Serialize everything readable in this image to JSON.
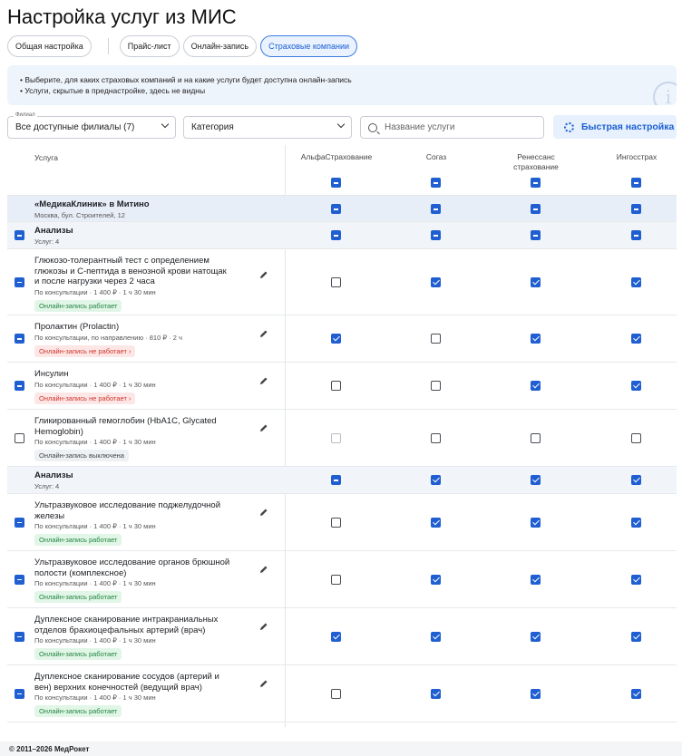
{
  "page_title": "Настройка услуг из МИС",
  "tabs": [
    {
      "label": "Общая настройка"
    },
    {
      "label": "Прайс-лист"
    },
    {
      "label": "Онлайн-запись"
    },
    {
      "label": "Страховые компании",
      "active": true
    }
  ],
  "info": {
    "lines": [
      "•  Выберите, для каких страховых компаний и на какие услуги будет доступна онлайн-запись",
      "•  Услуги, скрытые в преднастройке, здесь не видны"
    ],
    "icon": "info-icon"
  },
  "filters": {
    "branch_label": "Филиал",
    "branch_value": "Все доступные филиалы (7)",
    "category_value": "Категория",
    "search_placeholder": "Название услуги",
    "quick_setup": "Быстрая настройка"
  },
  "table": {
    "service_header": "Услуга",
    "insurers": [
      {
        "line1": "АльфаСтрахование",
        "line2": "",
        "header_state": "ind"
      },
      {
        "line1": "Согаз",
        "line2": "",
        "header_state": "ind"
      },
      {
        "line1": "Ренессанс",
        "line2": "страхование",
        "header_state": "ind"
      },
      {
        "line1": "Ингосстрах",
        "line2": "",
        "header_state": "ind"
      }
    ],
    "branch": {
      "title": "«МедикаКлиник» в Митино",
      "subtitle": "Москва, бул. Строителей, 12",
      "states": [
        "ind",
        "ind",
        "ind",
        "ind"
      ]
    },
    "groups": [
      {
        "title": "Анализы",
        "count": "Услуг: 4",
        "row_state": "ind",
        "states": [
          "ind",
          "ind",
          "ind",
          "ind"
        ],
        "services": [
          {
            "lines": [
              "Глюкозо-толерантный тест с определением",
              "глюкозы и С-пептида в венозной крови натощак",
              "и после нагрузки через 2 часа"
            ],
            "meta": "По консультации · 1 400 ₽ · 1 ч 30 мин",
            "status": "Онлайн-запись работает",
            "status_type": "ok",
            "row_state": "ind",
            "states": [
              "off",
              "on",
              "on",
              "on"
            ]
          },
          {
            "lines": [
              "Пролактин (Prolactin)"
            ],
            "meta": "По консультации, по направлению · 810 ₽ · 2 ч",
            "status": "Онлайн-запись не работает  ›",
            "status_type": "bad",
            "row_state": "ind",
            "states": [
              "on",
              "off",
              "on",
              "on"
            ]
          },
          {
            "lines": [
              "Инсулин"
            ],
            "meta": "По консультации · 1 400 ₽ · 1 ч 30 мин",
            "status": "Онлайн-запись не работает  ›",
            "status_type": "bad",
            "row_state": "ind",
            "states": [
              "off",
              "off",
              "on",
              "on"
            ]
          },
          {
            "lines": [
              "Гликированный гемоглобин (HbA1C, Glycated",
              "Hemoglobin)"
            ],
            "meta": "По консультации · 1 400 ₽ · 1 ч 30 мин",
            "status": "Онлайн-запись выключена",
            "status_type": "off",
            "row_state": "off",
            "states": [
              "dis",
              "off",
              "off",
              "off"
            ]
          }
        ]
      },
      {
        "title": "Анализы",
        "count": "Услуг: 4",
        "row_state": "",
        "states": [
          "ind",
          "on",
          "on",
          "on"
        ],
        "services": [
          {
            "lines": [
              "Ультразвуковое исследование поджелудочной",
              "железы"
            ],
            "meta": "По консультации · 1 400 ₽ · 1 ч 30 мин",
            "status": "Онлайн-запись работает",
            "status_type": "ok",
            "row_state": "ind",
            "states": [
              "off",
              "on",
              "on",
              "on"
            ]
          },
          {
            "lines": [
              "Ультразвуковое исследование органов брюшной",
              "полости (комплексное)"
            ],
            "meta": "По консультации · 1 400 ₽ · 1 ч 30 мин",
            "status": "Онлайн-запись работает",
            "status_type": "ok",
            "row_state": "ind",
            "states": [
              "off",
              "on",
              "on",
              "on"
            ]
          },
          {
            "lines": [
              "Дуплексное сканирование интракраниальных",
              "отделов брахиоцефальных артерий (врач)"
            ],
            "meta": "По консультации · 1 400 ₽ · 1 ч 30 мин",
            "status": "Онлайн-запись работает",
            "status_type": "ok",
            "row_state": "ind",
            "states": [
              "on",
              "on",
              "on",
              "on"
            ]
          },
          {
            "lines": [
              "Дуплексное сканирование сосудов (артерий и",
              "вен) верхних конечностей (ведущий врач)"
            ],
            "meta": "По консультации · 1 400 ₽ · 1 ч 30 мин",
            "status": "Онлайн-запись работает",
            "status_type": "ok",
            "row_state": "ind",
            "states": [
              "off",
              "on",
              "on",
              "on"
            ]
          }
        ]
      }
    ]
  },
  "footer": "© 2011–2026 МедРокет"
}
